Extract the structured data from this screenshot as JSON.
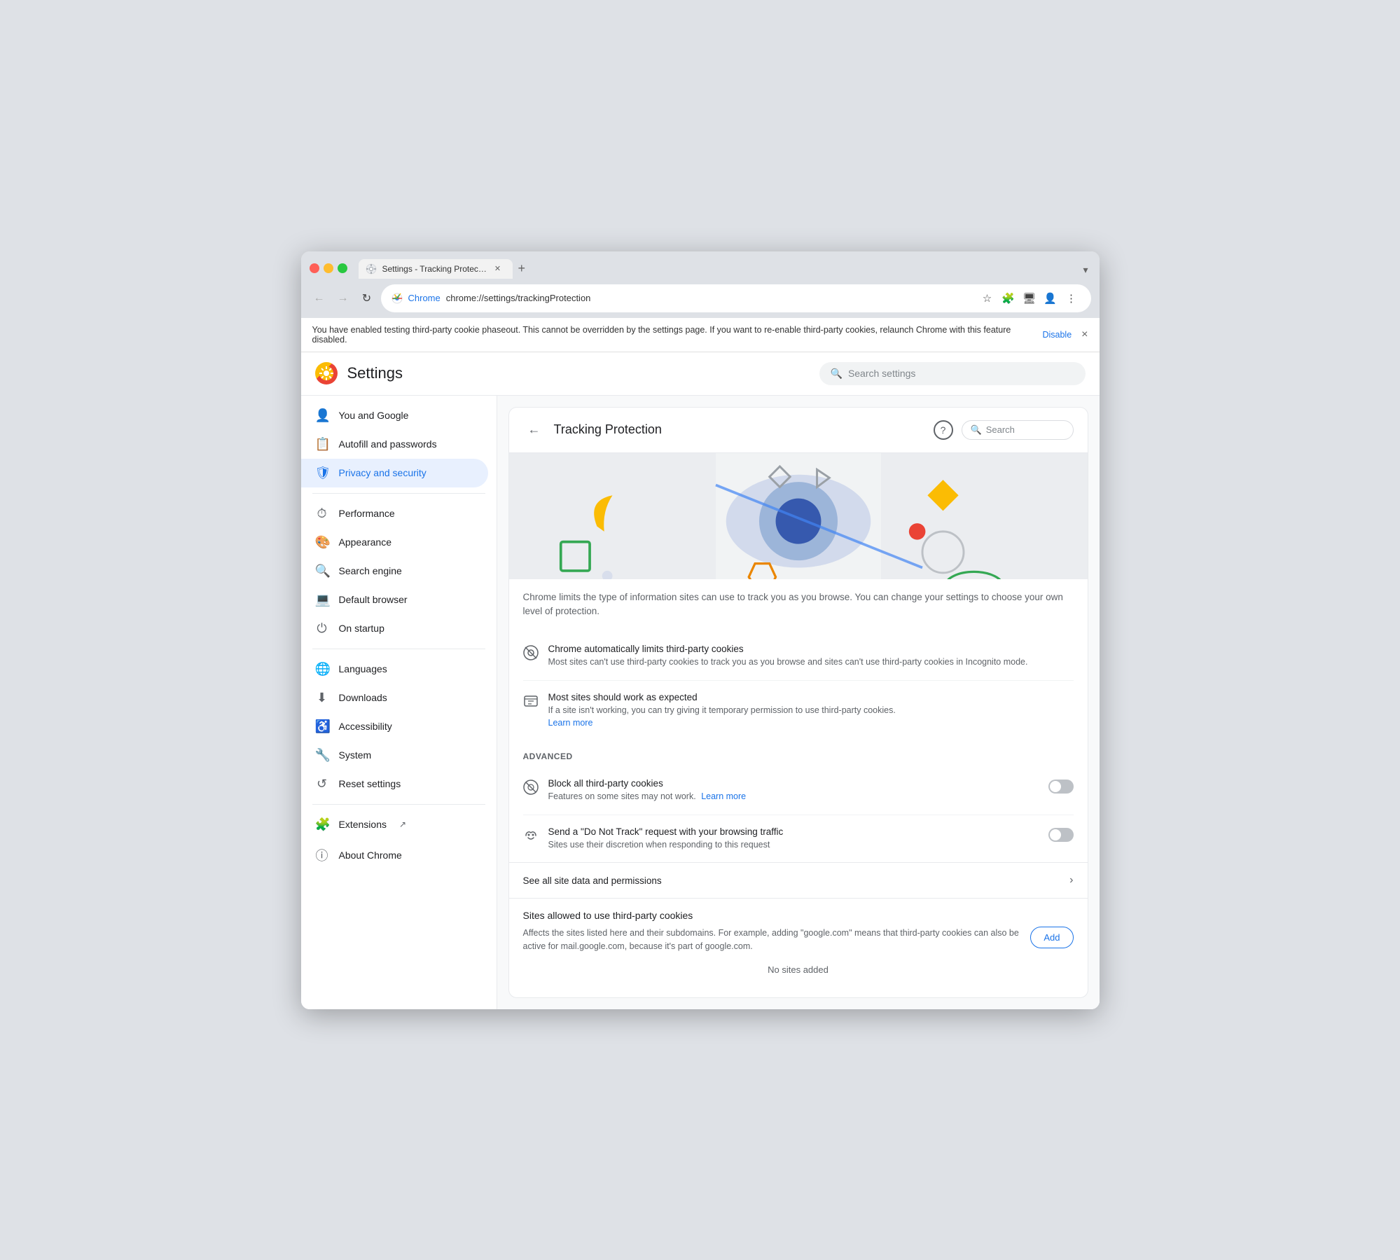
{
  "browser": {
    "tab_title": "Settings - Tracking Protectio",
    "new_tab_label": "+",
    "dropdown_label": "▾",
    "url_chrome": "Chrome",
    "url_address": "chrome://settings/trackingProtection",
    "nav": {
      "back_label": "←",
      "forward_label": "→",
      "reload_label": "↻"
    }
  },
  "banner": {
    "text": "You have enabled testing third-party cookie phaseout. This cannot be overridden by the settings page. If you want to re-enable third-party cookies, relaunch Chrome with this feature disabled.",
    "link_label": "Disable",
    "close_label": "×"
  },
  "settings": {
    "logo_emoji": "⚙",
    "title": "Settings",
    "search_placeholder": "Search settings",
    "sidebar": {
      "items": [
        {
          "id": "you-and-google",
          "icon": "👤",
          "label": "You and Google"
        },
        {
          "id": "autofill",
          "icon": "📋",
          "label": "Autofill and passwords"
        },
        {
          "id": "privacy",
          "icon": "🛡",
          "label": "Privacy and security",
          "active": true
        },
        {
          "id": "performance",
          "icon": "⏱",
          "label": "Performance"
        },
        {
          "id": "appearance",
          "icon": "🎨",
          "label": "Appearance"
        },
        {
          "id": "search-engine",
          "icon": "🔍",
          "label": "Search engine"
        },
        {
          "id": "default-browser",
          "icon": "💻",
          "label": "Default browser"
        },
        {
          "id": "on-startup",
          "icon": "⏻",
          "label": "On startup"
        },
        {
          "id": "languages",
          "icon": "🌐",
          "label": "Languages"
        },
        {
          "id": "downloads",
          "icon": "⬇",
          "label": "Downloads"
        },
        {
          "id": "accessibility",
          "icon": "♿",
          "label": "Accessibility"
        },
        {
          "id": "system",
          "icon": "🔧",
          "label": "System"
        },
        {
          "id": "reset-settings",
          "icon": "↺",
          "label": "Reset settings"
        }
      ],
      "divider_after": [
        2,
        7,
        12
      ],
      "bottom_items": [
        {
          "id": "extensions",
          "icon": "🧩",
          "label": "Extensions",
          "external": true
        },
        {
          "id": "about-chrome",
          "icon": "ⓘ",
          "label": "About Chrome"
        }
      ]
    },
    "content": {
      "back_label": "←",
      "title": "Tracking Protection",
      "help_label": "?",
      "search_placeholder": "Search",
      "description": "Chrome limits the type of information sites can use to track you as you browse. You can change your settings to choose your own level of protection.",
      "auto_limit_title": "Chrome automatically limits third-party cookies",
      "auto_limit_desc": "Most sites can't use third-party cookies to track you as you browse and sites can't use third-party cookies in Incognito mode.",
      "work_expected_title": "Most sites should work as expected",
      "work_expected_desc": "If a site isn't working, you can try giving it temporary permission to use third-party cookies.",
      "learn_more_1": "Learn more",
      "advanced_label": "Advanced",
      "block_all_title": "Block all third-party cookies",
      "block_all_desc": "Features on some sites may not work.",
      "block_all_link": "Learn more",
      "dnt_title": "Send a \"Do Not Track\" request with your browsing traffic",
      "dnt_desc": "Sites use their discretion when responding to this request",
      "block_all_toggle": "off",
      "dnt_toggle": "off",
      "site_data_label": "See all site data and permissions",
      "sites_title": "Sites allowed to use third-party cookies",
      "sites_desc": "Affects the sites listed here and their subdomains. For example, adding \"google.com\" means that third-party cookies can also be active for mail.google.com, because it's part of google.com.",
      "add_label": "Add",
      "no_sites_label": "No sites added"
    }
  }
}
